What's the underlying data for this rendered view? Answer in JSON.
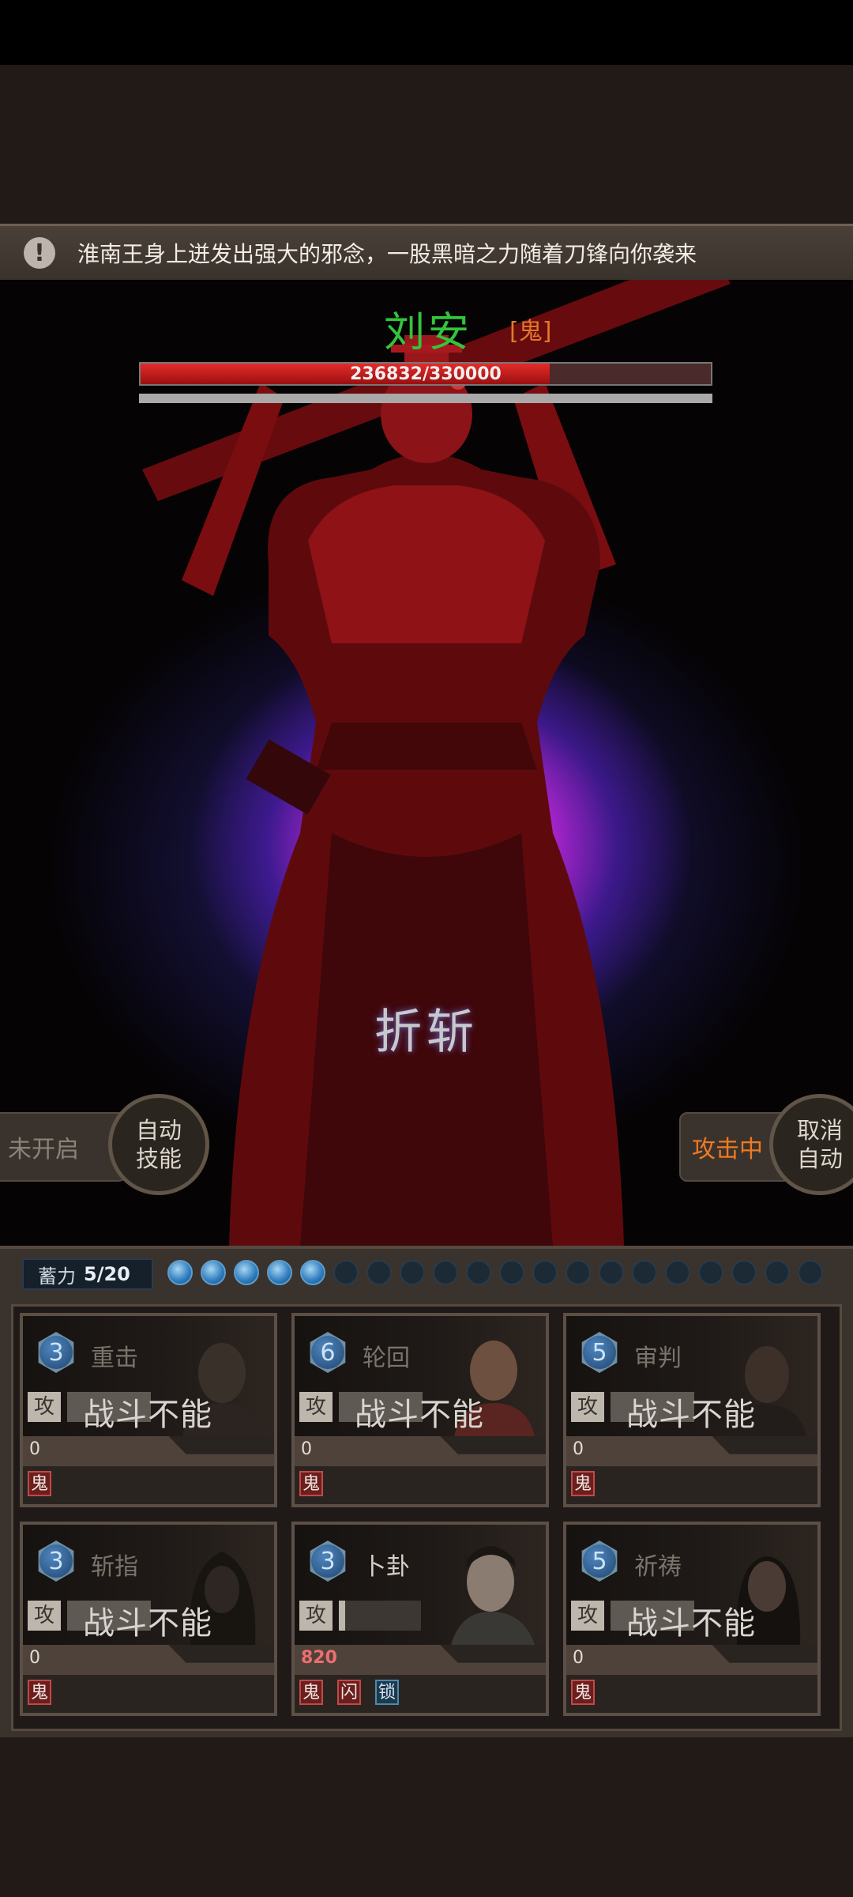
{
  "notice": {
    "icon": "exclamation-icon",
    "icon_glyph": "!",
    "text": "淮南王身上迸发出强大的邪念，一股黑暗之力随着刀锋向你袭来"
  },
  "boss": {
    "name": "刘安",
    "type_tag": "[鬼]",
    "hp_text": "236832/330000",
    "hp_current": 236832,
    "hp_max": 330000,
    "hp_fraction": 0.7177
  },
  "current_skill": "折斩",
  "left_control": {
    "status": "未开启",
    "button": "自动\n技能"
  },
  "right_control": {
    "status": "攻击中",
    "button": "取消\n自动"
  },
  "energy": {
    "label": "蓄力",
    "value": "5/20",
    "current": 5,
    "max": 20
  },
  "cards": [
    {
      "level": "3",
      "name": "重击",
      "atk": "攻",
      "status": "战斗不能",
      "value": "0",
      "tags": [
        {
          "text": "鬼",
          "color": "red"
        }
      ]
    },
    {
      "level": "6",
      "name": "轮回",
      "atk": "攻",
      "status": "战斗不能",
      "value": "0",
      "tags": [
        {
          "text": "鬼",
          "color": "red"
        }
      ]
    },
    {
      "level": "5",
      "name": "审判",
      "atk": "攻",
      "status": "战斗不能",
      "value": "0",
      "tags": [
        {
          "text": "鬼",
          "color": "red"
        }
      ]
    },
    {
      "level": "3",
      "name": "斩指",
      "atk": "攻",
      "status": "战斗不能",
      "value": "0",
      "tags": [
        {
          "text": "鬼",
          "color": "red"
        }
      ]
    },
    {
      "level": "3",
      "name": "卜卦",
      "atk": "攻",
      "status": "",
      "value": "820",
      "tags": [
        {
          "text": "鬼",
          "color": "red"
        },
        {
          "text": "闪",
          "color": "red"
        },
        {
          "text": "锁",
          "color": "blue"
        }
      ]
    },
    {
      "level": "5",
      "name": "祈祷",
      "atk": "攻",
      "status": "战斗不能",
      "value": "0",
      "tags": [
        {
          "text": "鬼",
          "color": "red"
        }
      ]
    }
  ],
  "colors": {
    "boss_name": "#33c43d",
    "boss_type": "#e0782a",
    "hp_fill": "#e52b2b",
    "attacking_status": "#ee7a22",
    "tag_red": "#c24848",
    "tag_blue": "#4a8ab0"
  }
}
